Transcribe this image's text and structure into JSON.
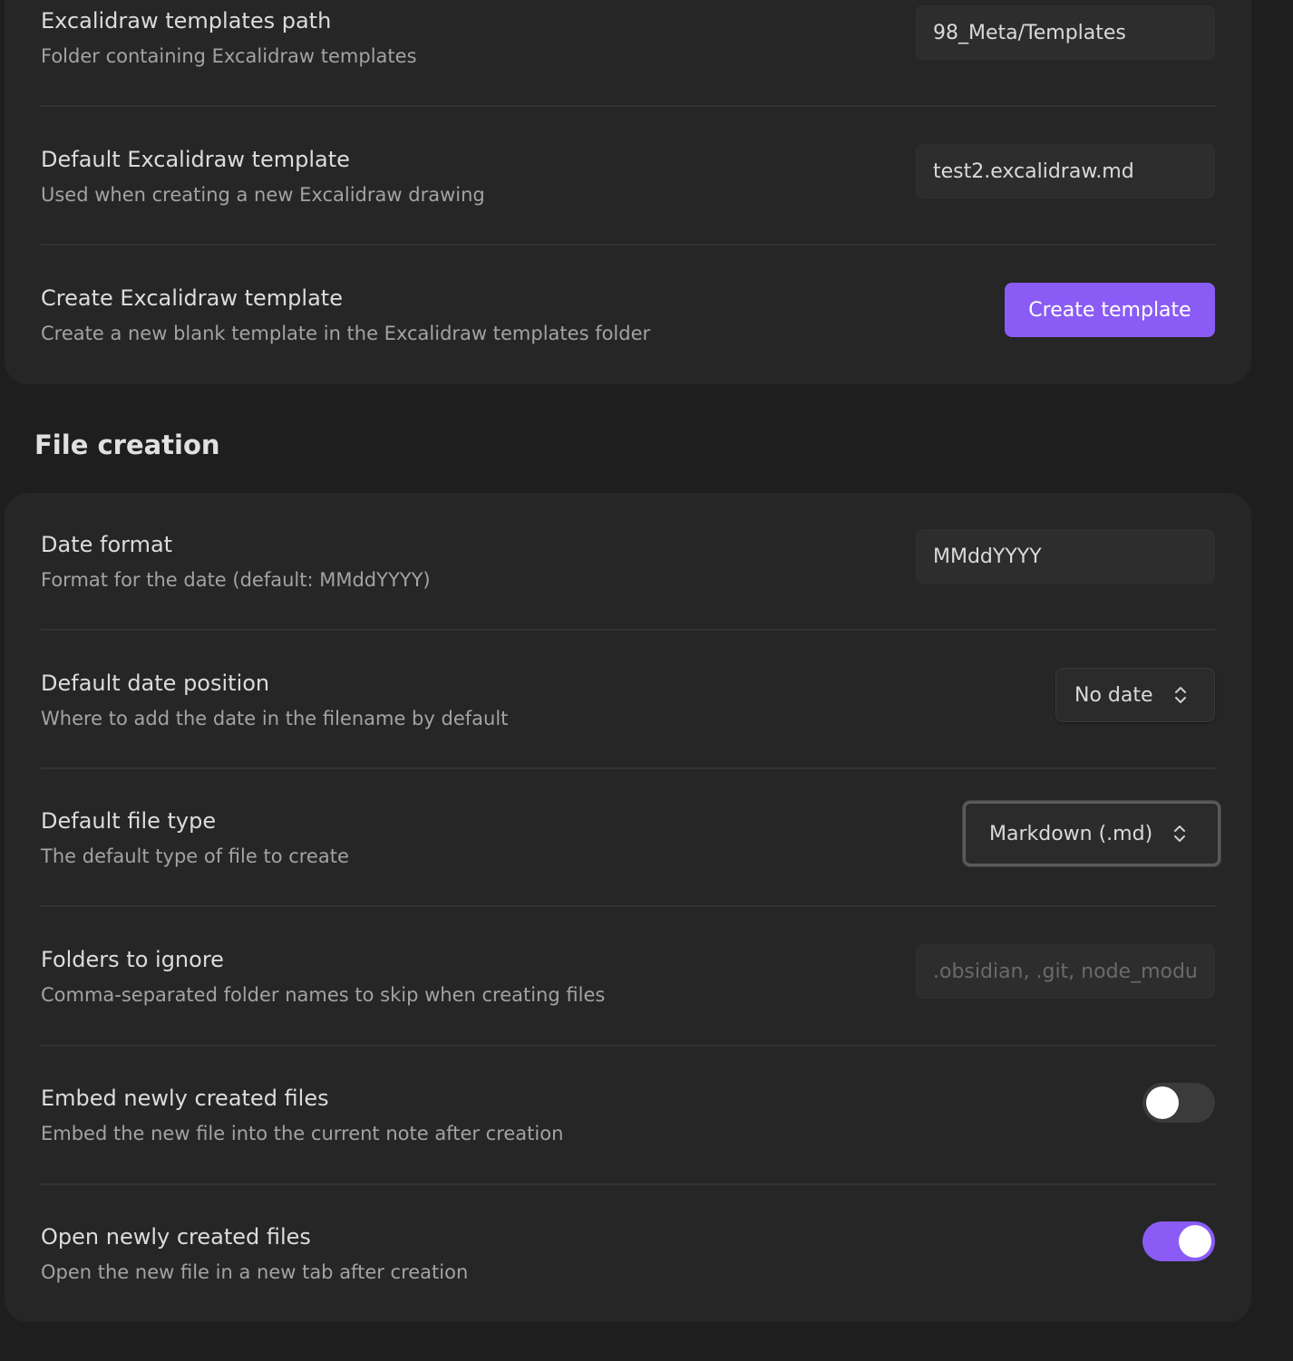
{
  "templates_section": {
    "rows": [
      {
        "title": "Excalidraw templates path",
        "description": "Folder containing Excalidraw templates",
        "value": "98_Meta/Templates"
      },
      {
        "title": "Default Excalidraw template",
        "description": "Used when creating a new Excalidraw drawing",
        "value": "test2.excalidraw.md"
      },
      {
        "title": "Create Excalidraw template",
        "description": "Create a new blank template in the Excalidraw templates folder",
        "button_label": "Create template"
      }
    ]
  },
  "file_creation": {
    "heading": "File creation",
    "date_format": {
      "title": "Date format",
      "description": "Format for the date (default: MMddYYYY)",
      "value": "MMddYYYY"
    },
    "date_position": {
      "title": "Default date position",
      "description": "Where to add the date in the filename by default",
      "selected": "No date"
    },
    "file_type": {
      "title": "Default file type",
      "description": "The default type of file to create",
      "selected": "Markdown (.md)"
    },
    "folders_ignore": {
      "title": "Folders to ignore",
      "description": "Comma-separated folder names to skip when creating files",
      "value": "",
      "placeholder": ".obsidian, .git, node_modules"
    },
    "embed_files": {
      "title": "Embed newly created files",
      "description": "Embed the new file into the current note after creation",
      "enabled": false
    },
    "open_files": {
      "title": "Open newly created files",
      "description": "Open the new file in a new tab after creation",
      "enabled": true
    }
  },
  "colors": {
    "accent": "#8a5cf5",
    "background": "#1e1e1e",
    "card": "#262626"
  },
  "icons": {
    "select_chevron": "chevron-up-down-icon"
  }
}
